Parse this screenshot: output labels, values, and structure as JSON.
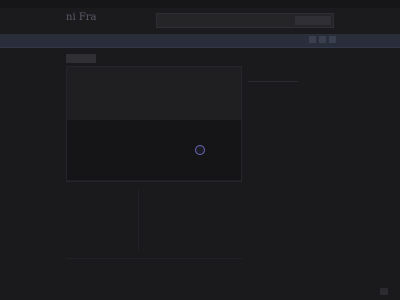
{
  "header": {
    "logo_text": "ni Fra"
  },
  "search": {
    "placeholder": "",
    "button_label": ""
  },
  "content": {
    "tab_label": "",
    "sidebar_title": "",
    "description_label": ""
  },
  "colors": {
    "spinner_accent": "#6b67b8",
    "navbar": "#2a2e3a",
    "background": "#1a1a1d"
  }
}
